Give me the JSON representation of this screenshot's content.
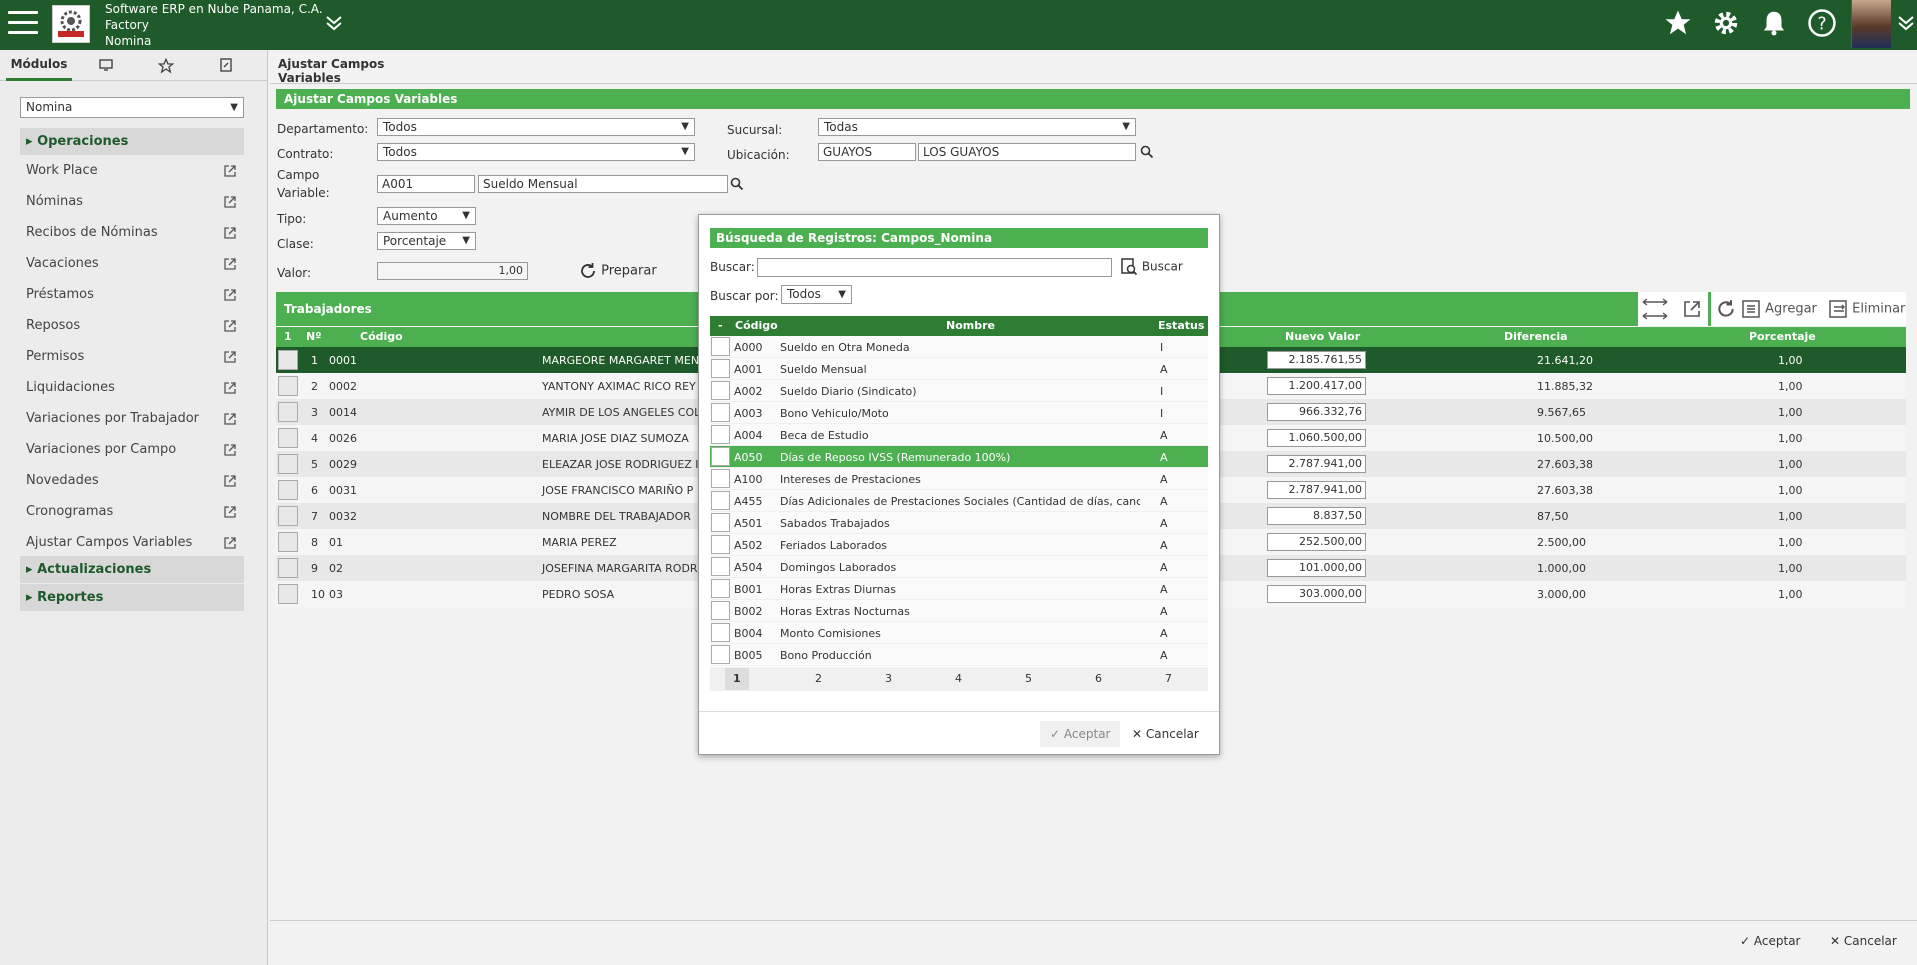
{
  "header": {
    "company": "Software ERP en Nube Panama, C.A.",
    "line2": "Factory",
    "line3": "Nomina"
  },
  "sidebar": {
    "tabs": [
      "Módulos"
    ],
    "module_select": "Nomina",
    "sections": {
      "operaciones": "Operaciones",
      "actualizaciones": "Actualizaciones",
      "reportes": "Reportes"
    },
    "items": [
      "Work Place",
      "Nóminas",
      "Recibos de Nóminas",
      "Vacaciones",
      "Préstamos",
      "Reposos",
      "Permisos",
      "Liquidaciones",
      "Variaciones por Trabajador",
      "Variaciones por Campo",
      "Novedades",
      "Cronogramas",
      "Ajustar Campos Variables"
    ]
  },
  "breadcrumb": "Ajustar Campos Variables",
  "form": {
    "title": "Ajustar Campos Variables",
    "departamento_label": "Departamento:",
    "departamento": "Todos",
    "sucursal_label": "Sucursal:",
    "sucursal": "Todas",
    "contrato_label": "Contrato:",
    "contrato": "Todos",
    "ubicacion_label": "Ubicación:",
    "ubicacion_code": "GUAYOS",
    "ubicacion_name": "LOS GUAYOS",
    "campo_label1": "Campo",
    "campo_label2": "Variable:",
    "campo_code": "A001",
    "campo_name": "Sueldo Mensual",
    "tipo_label": "Tipo:",
    "tipo": "Aumento",
    "clase_label": "Clase:",
    "clase": "Porcentaje",
    "valor_label": "Valor:",
    "valor": "1,00",
    "preparar": "Preparar"
  },
  "grid": {
    "title": "Trabajadores",
    "agregar": "Agregar",
    "eliminar": "Eliminar",
    "headers": {
      "sel": "1",
      "n": "Nº",
      "codigo": "Código",
      "nuevo": "Nuevo Valor",
      "diferencia": "Diferencia",
      "porcentaje": "Porcentaje"
    },
    "rows": [
      {
        "n": "1",
        "codigo": "0001",
        "nombre": "MARGEORE MARGARET MEND",
        "nuevo": "2.185.761,55",
        "dif": "21.641,20",
        "pct": "1,00"
      },
      {
        "n": "2",
        "codigo": "0002",
        "nombre": "YANTONY AXIMAC RICO REY",
        "nuevo": "1.200.417,00",
        "dif": "11.885,32",
        "pct": "1,00"
      },
      {
        "n": "3",
        "codigo": "0014",
        "nombre": "AYMIR DE LOS ANGELES COL",
        "nuevo": "966.332,76",
        "dif": "9.567,65",
        "pct": "1,00"
      },
      {
        "n": "4",
        "codigo": "0026",
        "nombre": "MARIA JOSE DIAZ SUMOZA",
        "nuevo": "1.060.500,00",
        "dif": "10.500,00",
        "pct": "1,00"
      },
      {
        "n": "5",
        "codigo": "0029",
        "nombre": "ELEAZAR JOSE RODRIGUEZ I",
        "nuevo": "2.787.941,00",
        "dif": "27.603,38",
        "pct": "1,00"
      },
      {
        "n": "6",
        "codigo": "0031",
        "nombre": "JOSE FRANCISCO MARIÑO P",
        "nuevo": "2.787.941,00",
        "dif": "27.603,38",
        "pct": "1,00"
      },
      {
        "n": "7",
        "codigo": "0032",
        "nombre": "NOMBRE DEL TRABAJADOR",
        "nuevo": "8.837,50",
        "dif": "87,50",
        "pct": "1,00"
      },
      {
        "n": "8",
        "codigo": "01",
        "nombre": "MARIA PEREZ",
        "nuevo": "252.500,00",
        "dif": "2.500,00",
        "pct": "1,00"
      },
      {
        "n": "9",
        "codigo": "02",
        "nombre": "JOSEFINA MARGARITA RODR",
        "nuevo": "101.000,00",
        "dif": "1.000,00",
        "pct": "1,00"
      },
      {
        "n": "10",
        "codigo": "03",
        "nombre": "PEDRO SOSA",
        "nuevo": "303.000,00",
        "dif": "3.000,00",
        "pct": "1,00"
      }
    ]
  },
  "footer": {
    "aceptar": "Aceptar",
    "cancelar": "Cancelar"
  },
  "modal": {
    "title": "Búsqueda de Registros: Campos_Nomina",
    "buscar_label": "Buscar:",
    "buscar_placeholder": "",
    "buscar_btn": "Buscar",
    "buscar_por_label": "Buscar por:",
    "buscar_por": "Todos",
    "headers": {
      "sel": "-",
      "codigo": "Código",
      "nombre": "Nombre",
      "estatus": "Estatus"
    },
    "rows": [
      {
        "codigo": "A000",
        "nombre": "Sueldo en Otra Moneda",
        "estatus": "I"
      },
      {
        "codigo": "A001",
        "nombre": "Sueldo Mensual",
        "estatus": "A"
      },
      {
        "codigo": "A002",
        "nombre": "Sueldo Diario (Sindicato)",
        "estatus": "I"
      },
      {
        "codigo": "A003",
        "nombre": "Bono Vehiculo/Moto",
        "estatus": "I"
      },
      {
        "codigo": "A004",
        "nombre": "Beca de Estudio",
        "estatus": "A"
      },
      {
        "codigo": "A050",
        "nombre": "Días de Reposo IVSS (Remunerado 100%)",
        "estatus": "A"
      },
      {
        "codigo": "A100",
        "nombre": "Intereses de Prestaciones",
        "estatus": "A"
      },
      {
        "codigo": "A455",
        "nombre": "Días Adicionales de Prestaciones Sociales (Cantidad de días, cancela",
        "estatus": "A"
      },
      {
        "codigo": "A501",
        "nombre": "Sabados Trabajados",
        "estatus": "A"
      },
      {
        "codigo": "A502",
        "nombre": "Feriados Laborados",
        "estatus": "A"
      },
      {
        "codigo": "A504",
        "nombre": "Domingos Laborados",
        "estatus": "A"
      },
      {
        "codigo": "B001",
        "nombre": "Horas Extras Diurnas",
        "estatus": "A"
      },
      {
        "codigo": "B002",
        "nombre": "Horas Extras Nocturnas",
        "estatus": "A"
      },
      {
        "codigo": "B004",
        "nombre": "Monto Comisiones",
        "estatus": "A"
      },
      {
        "codigo": "B005",
        "nombre": "Bono Producción",
        "estatus": "A"
      }
    ],
    "pages": [
      "1",
      "2",
      "3",
      "4",
      "5",
      "6",
      "7"
    ],
    "aceptar": "Aceptar",
    "cancelar": "Cancelar"
  },
  "colors": {
    "topbar": "#1e5a2a",
    "accent": "#4caf50",
    "selected_row": "#1e5a2a"
  }
}
